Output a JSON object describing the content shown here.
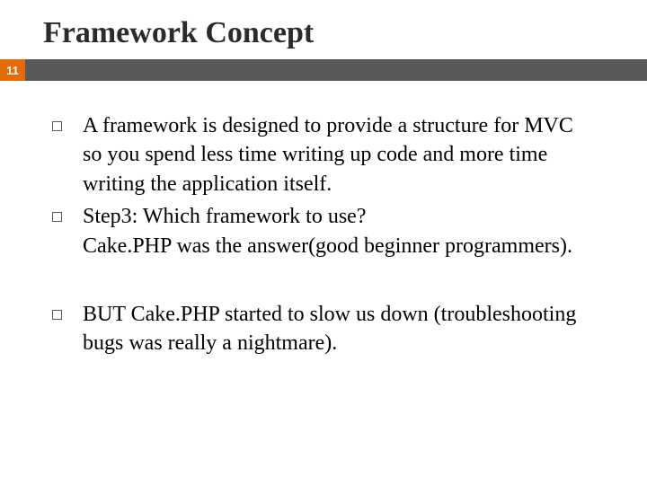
{
  "title": "Framework Concept",
  "pageNumber": "11",
  "bullets": {
    "b1": "A framework is designed to provide a structure for MVC so you spend less time writing up  code  and more time writing the application itself.",
    "b2_line1": "Step3: Which framework to use?",
    "b2_line2": "Cake.PHP was the answer(good beginner programmers).",
    "b3": "BUT Cake.PHP started to slow us down (troubleshooting bugs was really a nightmare)."
  }
}
